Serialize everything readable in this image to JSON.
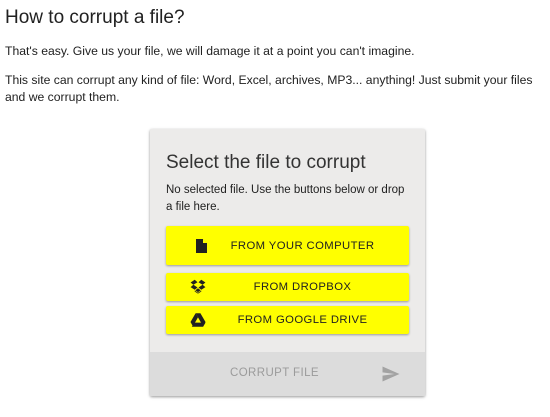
{
  "page": {
    "heading": "How to corrupt a file?",
    "intro": "That's easy. Give us your file, we will damage it at a point you can't imagine.",
    "description": "This site can corrupt any kind of file: Word, Excel, archives, MP3... anything! Just submit your files and we corrupt them."
  },
  "card": {
    "title": "Select the file to corrupt",
    "note": "No selected file. Use the buttons below or drop a file here.",
    "buttons": {
      "computer": {
        "label": "FROM YOUR COMPUTER",
        "icon": "file-icon"
      },
      "dropbox": {
        "label": "FROM DROPBOX",
        "icon": "dropbox-icon"
      },
      "drive": {
        "label": "FROM GOOGLE DRIVE",
        "icon": "google-drive-icon"
      }
    },
    "submit": {
      "label": "CORRUPT FILE",
      "icon": "send-icon"
    }
  },
  "colors": {
    "button_bg": "#ffff00",
    "card_bg": "#ecebea",
    "footer_bg": "#dcdcdc",
    "disabled_text": "#9b9b9b"
  }
}
